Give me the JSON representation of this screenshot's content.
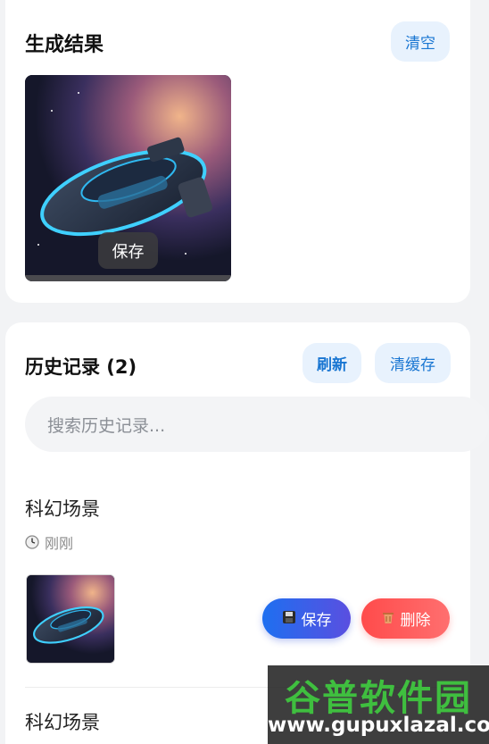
{
  "results": {
    "title": "生成结果",
    "clear_label": "清空",
    "image_save_label": "保存"
  },
  "history": {
    "title": "历史记录 (2)",
    "refresh_label": "刷新",
    "clear_cache_label": "清缓存",
    "search_placeholder": "搜索历史记录...",
    "items": [
      {
        "title": "科幻场景",
        "time": "刚刚",
        "save_label": "保存",
        "delete_label": "删除"
      },
      {
        "title": "科幻场景"
      }
    ]
  },
  "watermark": {
    "cn": "谷普软件园",
    "en": "www.gupuxlazal.com"
  },
  "colors": {
    "accent": "#1976d2",
    "chip_bg": "#e8f2fd",
    "save_gradient_start": "#1e6ff0",
    "save_gradient_end": "#5a4fe0",
    "delete": "#ff4b4b"
  },
  "icons": {
    "clock": "clock-icon",
    "save": "floppy-disk-icon",
    "delete": "trash-icon"
  }
}
